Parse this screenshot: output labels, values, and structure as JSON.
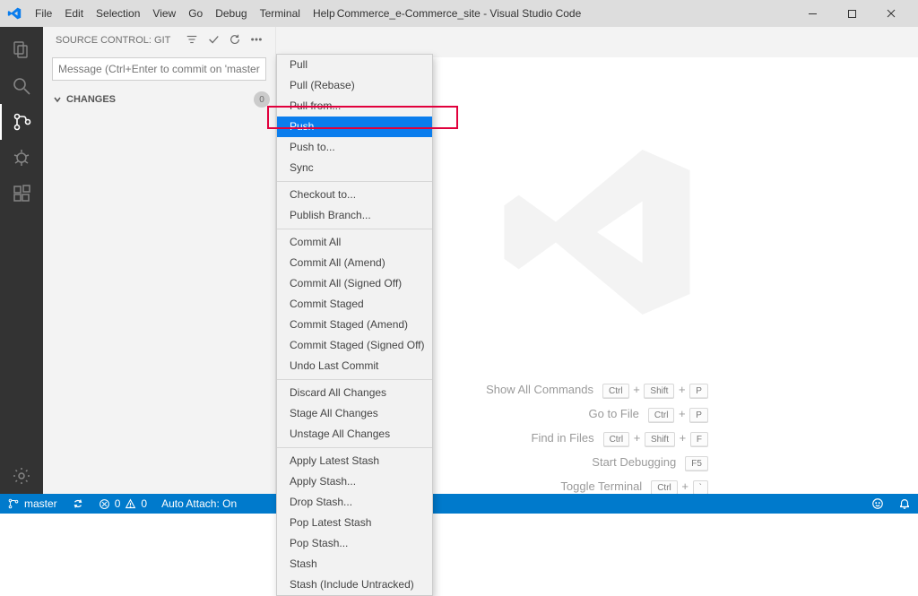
{
  "title": "Commerce_e-Commerce_site - Visual Studio Code",
  "menubar": [
    "File",
    "Edit",
    "Selection",
    "View",
    "Go",
    "Debug",
    "Terminal",
    "Help"
  ],
  "source_control": {
    "header": "SOURCE CONTROL: GIT",
    "commit_placeholder": "Message (Ctrl+Enter to commit on 'master')",
    "changes_label": "CHANGES",
    "changes_count": "0"
  },
  "context_menu": {
    "selected_index": 3,
    "groups": [
      [
        "Pull",
        "Pull (Rebase)",
        "Pull from...",
        "Push",
        "Push to...",
        "Sync"
      ],
      [
        "Checkout to...",
        "Publish Branch..."
      ],
      [
        "Commit All",
        "Commit All (Amend)",
        "Commit All (Signed Off)",
        "Commit Staged",
        "Commit Staged (Amend)",
        "Commit Staged (Signed Off)",
        "Undo Last Commit"
      ],
      [
        "Discard All Changes",
        "Stage All Changes",
        "Unstage All Changes"
      ],
      [
        "Apply Latest Stash",
        "Apply Stash...",
        "Drop Stash...",
        "Pop Latest Stash",
        "Pop Stash...",
        "Stash",
        "Stash (Include Untracked)"
      ]
    ]
  },
  "welcome_shortcuts": [
    {
      "label": "Show All Commands",
      "keys": [
        "Ctrl",
        "Shift",
        "P"
      ]
    },
    {
      "label": "Go to File",
      "keys": [
        "Ctrl",
        "P"
      ]
    },
    {
      "label": "Find in Files",
      "keys": [
        "Ctrl",
        "Shift",
        "F"
      ]
    },
    {
      "label": "Start Debugging",
      "keys": [
        "F5"
      ]
    },
    {
      "label": "Toggle Terminal",
      "keys": [
        "Ctrl",
        "`"
      ]
    }
  ],
  "statusbar": {
    "branch": "master",
    "errors": "0",
    "warnings": "0",
    "autoattach": "Auto Attach: On"
  }
}
